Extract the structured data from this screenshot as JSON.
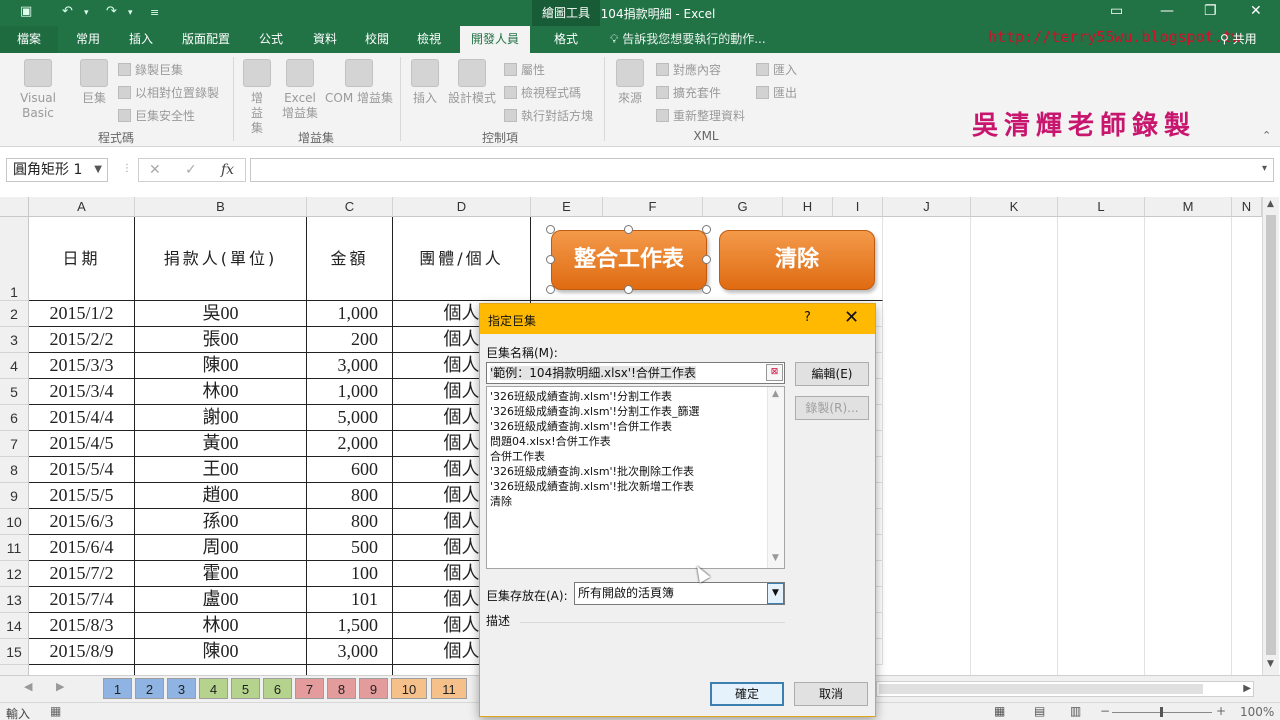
{
  "window": {
    "title": "範例：104捐款明細 - Excel",
    "context_tab": "繪圖工具"
  },
  "tabs": [
    "檔案",
    "常用",
    "插入",
    "版面配置",
    "公式",
    "資料",
    "校閱",
    "檢視",
    "開發人員",
    "格式"
  ],
  "active_tab": "開發人員",
  "tell_me": "告訴我您想要執行的動作...",
  "share": "共用",
  "watermark": {
    "url": "http://terry55wu.blogspot.tw",
    "name": "吳清輝老師錄製"
  },
  "ribbon": {
    "code": {
      "label": "程式碼",
      "visual_basic": "Visual Basic",
      "macros": "巨集",
      "record_macro": "錄製巨集",
      "relative_refs": "以相對位置錄製",
      "macro_security": "巨集安全性"
    },
    "addins": {
      "label": "增益集",
      "addins": "增益集",
      "excel_addins": "Excel 增益集",
      "com_addins": "COM 增益集"
    },
    "controls": {
      "label": "控制項",
      "insert": "插入",
      "design_mode": "設計模式",
      "properties": "屬性",
      "view_code": "檢視程式碼",
      "run_dialog": "執行對話方塊"
    },
    "xml": {
      "label": "XML",
      "source": "來源",
      "map_properties": "對應內容",
      "expansion_packs": "擴充套件",
      "refresh_data": "重新整理資料",
      "import": "匯入",
      "export": "匯出"
    }
  },
  "formula_bar": {
    "name_box": "圓角矩形 1",
    "cancel": "✕",
    "enter": "✓",
    "fx": "fx",
    "value": ""
  },
  "columns": [
    "A",
    "B",
    "C",
    "D",
    "E",
    "F",
    "G",
    "H",
    "I",
    "J",
    "K",
    "L",
    "M",
    "N"
  ],
  "row_numbers": [
    "1",
    "2",
    "3",
    "4",
    "5",
    "6",
    "7",
    "8",
    "9",
    "10",
    "11",
    "12",
    "13",
    "14",
    "15"
  ],
  "table": {
    "headers": [
      "日期",
      "捐款人(單位)",
      "金額",
      "團體/個人"
    ],
    "rows": [
      [
        "2015/1/2",
        "吳00",
        "1,000",
        "個人"
      ],
      [
        "2015/2/2",
        "張00",
        "200",
        "個人"
      ],
      [
        "2015/3/3",
        "陳00",
        "3,000",
        "個人"
      ],
      [
        "2015/3/4",
        "林00",
        "1,000",
        "個人"
      ],
      [
        "2015/4/4",
        "謝00",
        "5,000",
        "個人"
      ],
      [
        "2015/4/5",
        "黃00",
        "2,000",
        "個人"
      ],
      [
        "2015/5/4",
        "王00",
        "600",
        "個人"
      ],
      [
        "2015/5/5",
        "趙00",
        "800",
        "個人"
      ],
      [
        "2015/6/3",
        "孫00",
        "800",
        "個人"
      ],
      [
        "2015/6/4",
        "周00",
        "500",
        "個人"
      ],
      [
        "2015/7/2",
        "霍00",
        "100",
        "個人"
      ],
      [
        "2015/7/4",
        "盧00",
        "101",
        "個人"
      ],
      [
        "2015/8/3",
        "林00",
        "1,500",
        "個人"
      ],
      [
        "2015/8/9",
        "陳00",
        "3,000",
        "個人"
      ]
    ]
  },
  "shape_buttons": {
    "merge": "整合工作表",
    "clear": "清除"
  },
  "sheet_tabs": [
    {
      "label": "1",
      "color": "#8fb4e3"
    },
    {
      "label": "2",
      "color": "#8fb4e3"
    },
    {
      "label": "3",
      "color": "#8fb4e3"
    },
    {
      "label": "4",
      "color": "#b5d38c"
    },
    {
      "label": "5",
      "color": "#b5d38c"
    },
    {
      "label": "6",
      "color": "#b5d38c"
    },
    {
      "label": "7",
      "color": "#e39b9b"
    },
    {
      "label": "8",
      "color": "#e39b9b"
    },
    {
      "label": "9",
      "color": "#e39b9b"
    },
    {
      "label": "10",
      "color": "#f5c08a"
    },
    {
      "label": "11",
      "color": "#f5c08a"
    }
  ],
  "status": {
    "mode": "輸入",
    "zoom": "100%"
  },
  "dialog": {
    "title": "指定巨集",
    "help": "?",
    "close": "✕",
    "macro_name_label": "巨集名稱(M):",
    "macro_name_value": "'範例：104捐款明細.xlsx'!合併工作表",
    "macro_list": [
      "'326班級成績查詢.xlsm'!分割工作表",
      "'326班級成績查詢.xlsm'!分割工作表_篩選",
      "'326班級成績查詢.xlsm'!合併工作表",
      "問題04.xlsx!合併工作表",
      "合併工作表",
      "'326班級成績查詢.xlsm'!批次刪除工作表",
      "'326班級成績查詢.xlsm'!批次新增工作表",
      "清除"
    ],
    "edit_button": "編輯(E)",
    "record_button": "錄製(R)...",
    "macros_in_label": "巨集存放在(A):",
    "macros_in_value": "所有開啟的活頁簿",
    "description_label": "描述",
    "ok_button": "確定",
    "cancel_button": "取消"
  },
  "colors": {
    "excel_green": "#217346",
    "dialog_title": "#ffb900",
    "shape_orange": "#e87a20"
  }
}
